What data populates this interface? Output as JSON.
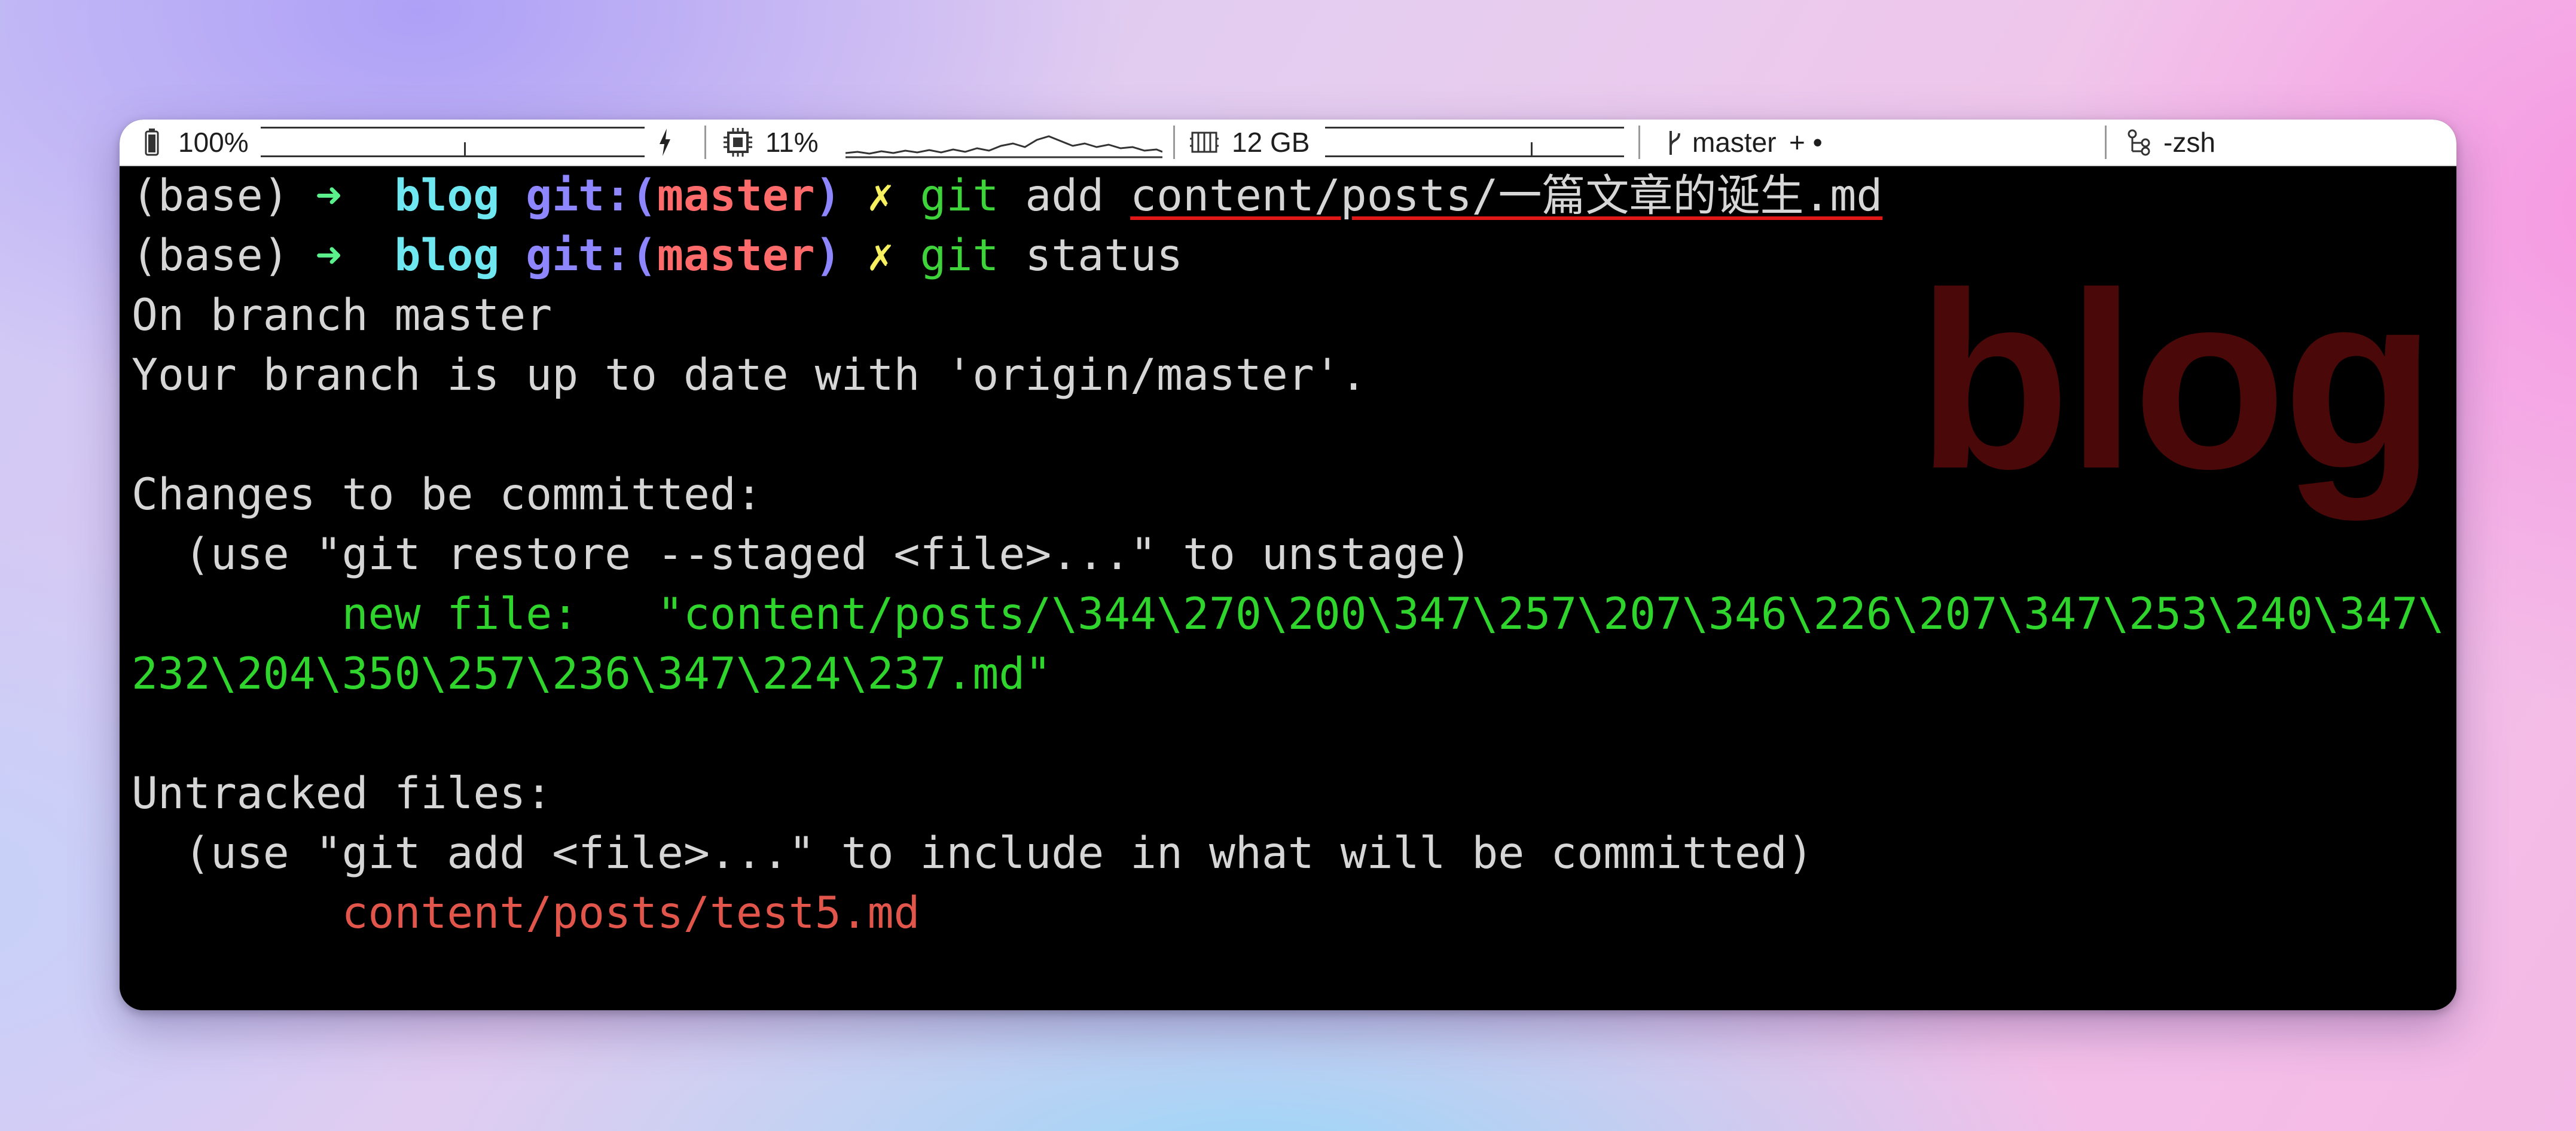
{
  "statusbar": {
    "battery": {
      "icon": "battery-icon",
      "value": "100%",
      "charging_icon": "lightning-icon"
    },
    "cpu": {
      "icon": "cpu-chip-icon",
      "value": "11%"
    },
    "memory": {
      "icon": "memory-icon",
      "value": "12 GB"
    },
    "git": {
      "icon": "git-branch-icon",
      "branch": "master",
      "suffix": "+ •"
    },
    "session": {
      "icon": "process-tree-icon",
      "label": "-zsh"
    }
  },
  "watermark": "blog",
  "terminal": {
    "prompt": {
      "env": "(base)",
      "arrow": "➜",
      "dir": "blog",
      "git_prefix": "git:(",
      "branch": "master",
      "git_suffix": ")",
      "dirty_mark": "✗"
    },
    "cmd1": {
      "program": "git",
      "args": "add",
      "path": "content/posts/一篇文章的诞生.md"
    },
    "cmd2": {
      "program": "git",
      "args": "status"
    },
    "output": {
      "l1": "On branch master",
      "l2": "Your branch is up to date with 'origin/master'.",
      "l3": "Changes to be committed:",
      "l4": "  (use \"git restore --staged <file>...\" to unstage)",
      "l5": "        new file:   \"content/posts/\\344\\270\\200\\347\\257\\207\\346\\226\\207\\347\\253\\240\\347\\",
      "l6": "232\\204\\350\\257\\236\\347\\224\\237.md\"",
      "l7": "Untracked files:",
      "l8": "  (use \"git add <file>...\" to include in what will be committed)",
      "l9": "        content/posts/test5.md"
    }
  },
  "colors": {
    "prompt_arrow": "#5cf08c",
    "dir": "#6fe7f0",
    "git_label": "#8e86ff",
    "branch": "#ff6a6a",
    "dirty_mark": "#f6f060",
    "command": "#3ed33a",
    "staged_file": "#2fd42c",
    "untracked_file": "#e2554a",
    "watermark": "#4a0808"
  }
}
